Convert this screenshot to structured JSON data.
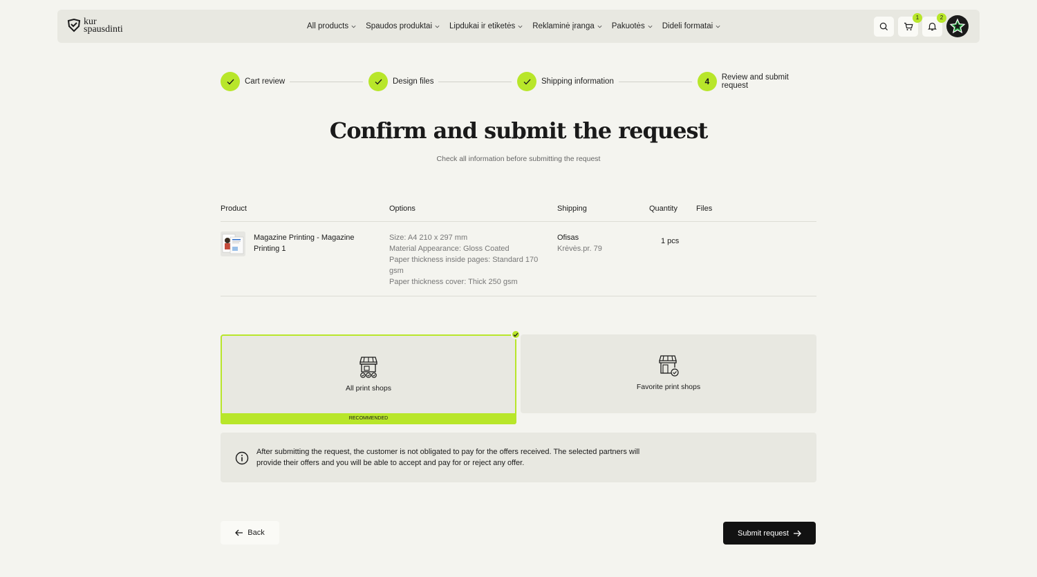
{
  "header": {
    "logo": {
      "line1": "kur",
      "line2": "spausdinti"
    },
    "nav": [
      {
        "label": "All products"
      },
      {
        "label": "Spaudos produktai"
      },
      {
        "label": "Lipdukai ir etiketės"
      },
      {
        "label": "Reklaminė įranga"
      },
      {
        "label": "Pakuotės"
      },
      {
        "label": "Dideli formatai"
      }
    ],
    "cart_count": "1",
    "notifications_count": "2",
    "icons": [
      "search-icon",
      "cart-icon",
      "bell-icon",
      "star-avatar"
    ]
  },
  "stepper": {
    "steps": [
      {
        "label": "Cart review",
        "state": "done"
      },
      {
        "label": "Design files",
        "state": "done"
      },
      {
        "label": "Shipping information",
        "state": "done"
      },
      {
        "label": "Review and submit request",
        "state": "current",
        "number": "4"
      }
    ]
  },
  "page": {
    "title": "Confirm and submit the request",
    "subtitle": "Check all information before submitting the request"
  },
  "table": {
    "headers": {
      "product": "Product",
      "options": "Options",
      "shipping": "Shipping",
      "quantity": "Quantity",
      "files": "Files"
    },
    "rows": [
      {
        "product": "Magazine Printing - Magazine Printing 1",
        "options": [
          "Size: A4 210 x 297 mm",
          "Material Appearance: Gloss Coated",
          "Paper thickness inside pages: Standard 170 gsm",
          "Paper thickness cover: Thick 250 gsm"
        ],
        "shipping_name": "Ofisas",
        "shipping_address": "Krėvės.pr. 79",
        "quantity": "1 pcs"
      }
    ]
  },
  "shops": {
    "all": {
      "label": "All print shops",
      "badge": "RECOMMENDED",
      "selected": true
    },
    "favorite": {
      "label": "Favorite print shops",
      "selected": false
    }
  },
  "info": {
    "text": "After submitting the request, the customer is not obligated to pay for the offers received. The selected partners will provide their offers and you will be able to accept and pay for or reject any offer."
  },
  "actions": {
    "back": "Back",
    "submit": "Submit request"
  },
  "colors": {
    "accent": "#b8e62a",
    "background": "#f4f4ef",
    "panel": "#e8e8e1",
    "primary_button": "#121212"
  }
}
